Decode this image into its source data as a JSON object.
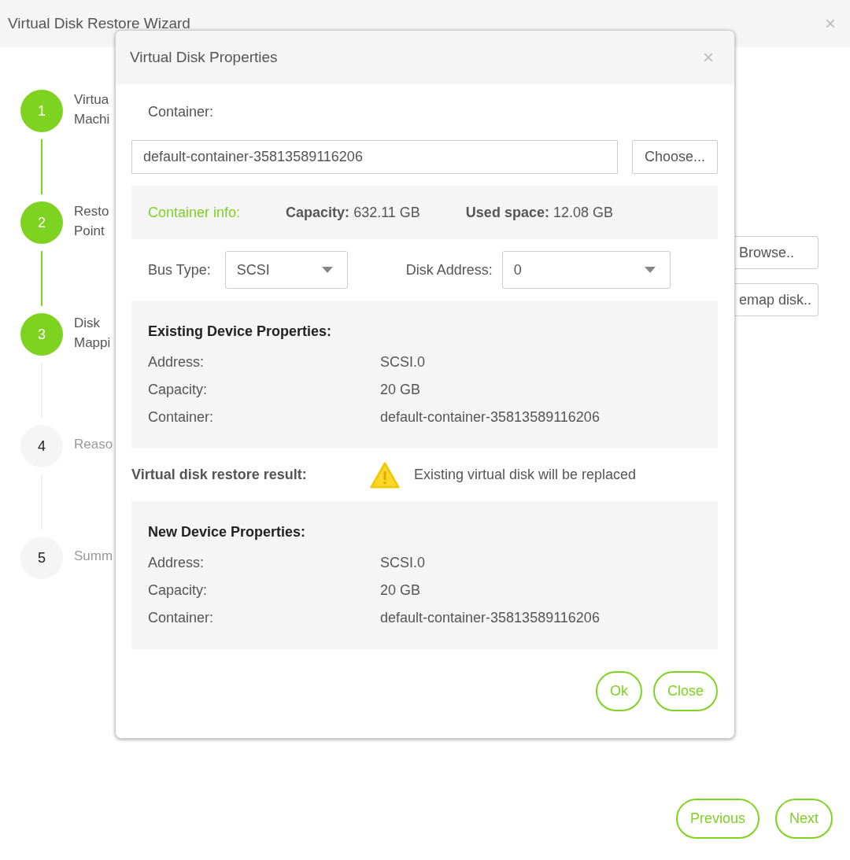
{
  "wizard": {
    "title": "Virtual Disk Restore Wizard",
    "close": "×"
  },
  "steps": [
    {
      "number": "1",
      "label": "Virtua\nMachi",
      "done": true
    },
    {
      "number": "2",
      "label": "Resto\nPoint",
      "done": true
    },
    {
      "number": "3",
      "label": "Disk\nMappi",
      "done": true
    },
    {
      "number": "4",
      "label": "Reaso",
      "done": false
    },
    {
      "number": "5",
      "label": "Summ",
      "done": false
    }
  ],
  "background_buttons": [
    "Browse..",
    "emap disk.."
  ],
  "dialog": {
    "title": "Virtual Disk Properties",
    "close": "×",
    "container_label": "Container:",
    "container_value": "default-container-35813589116206",
    "choose_button": "Choose...",
    "info": {
      "label": "Container info:",
      "items": [
        {
          "key": "Capacity:",
          "value": "632.11 GB"
        },
        {
          "key": "Used space:",
          "value": "12.08 GB"
        }
      ]
    },
    "bus": {
      "label": "Bus Type:",
      "value": "SCSI"
    },
    "address": {
      "label": "Disk Address:",
      "value": "0"
    },
    "existing": {
      "heading": "Existing Device Properties:",
      "rows": [
        {
          "key": "Address:",
          "value": "SCSI.0"
        },
        {
          "key": "Capacity:",
          "value": "20 GB"
        },
        {
          "key": "Container:",
          "value": "default-container-35813589116206"
        }
      ]
    },
    "result": {
      "label": "Virtual disk restore result:",
      "message": "Existing virtual disk will be replaced"
    },
    "new": {
      "heading": "New Device Properties:",
      "rows": [
        {
          "key": "Address:",
          "value": "SCSI.0"
        },
        {
          "key": "Capacity:",
          "value": "20 GB"
        },
        {
          "key": "Container:",
          "value": "default-container-35813589116206"
        }
      ]
    },
    "buttons": [
      "Ok",
      "Close"
    ]
  },
  "nav_buttons": [
    "Previous",
    "Next"
  ]
}
